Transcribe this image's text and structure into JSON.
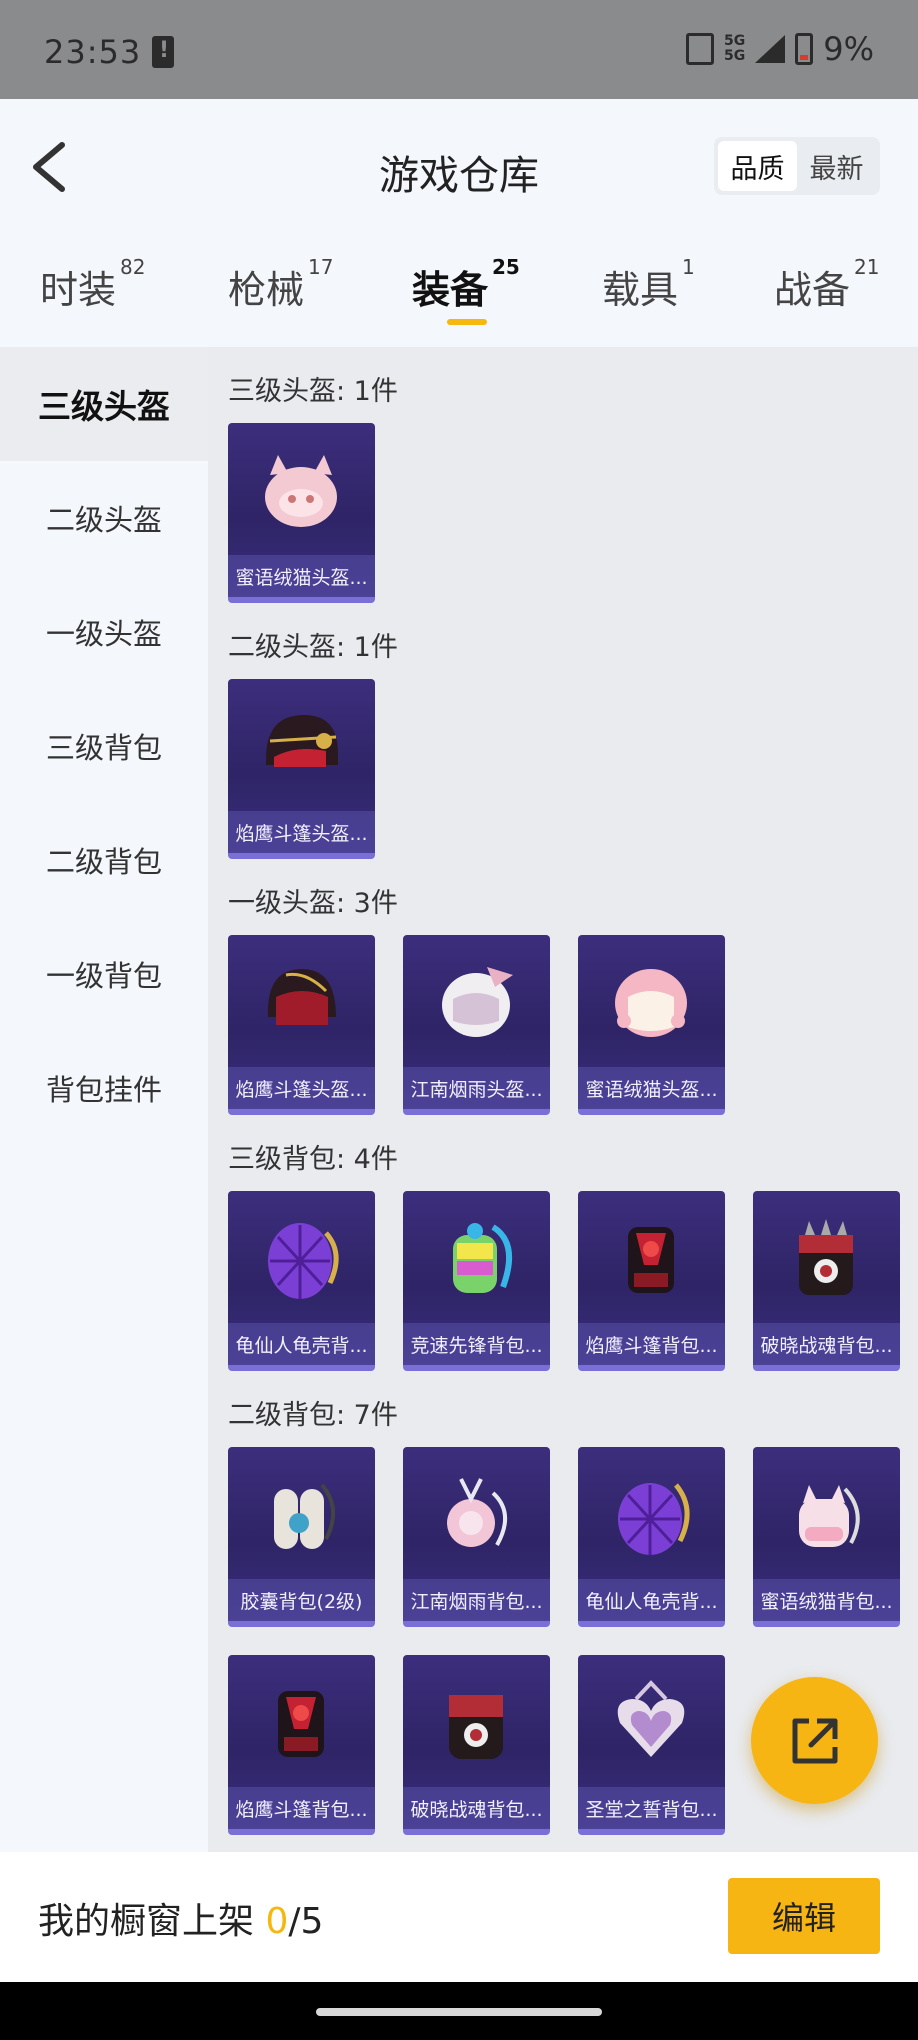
{
  "status": {
    "time": "23:53",
    "network": "5G",
    "battery": "9%"
  },
  "header": {
    "title": "游戏仓库",
    "sort_options": [
      "品质",
      "最新"
    ],
    "sort_active": "品质"
  },
  "tabs": [
    {
      "label": "时装",
      "count": "82"
    },
    {
      "label": "枪械",
      "count": "17"
    },
    {
      "label": "装备",
      "count": "25"
    },
    {
      "label": "载具",
      "count": "1"
    },
    {
      "label": "战备",
      "count": "21"
    }
  ],
  "sidebar": {
    "active": "三级头盔",
    "items": [
      "三级头盔",
      "二级头盔",
      "一级头盔",
      "三级背包",
      "二级背包",
      "一级背包",
      "背包挂件"
    ]
  },
  "sections": [
    {
      "title": "三级头盔: 1件",
      "items": [
        {
          "name": "蜜语绒猫头盔...",
          "icon": "pink-cat-helmet"
        }
      ]
    },
    {
      "title": "二级头盔: 1件",
      "items": [
        {
          "name": "焰鹰斗篷头盔...",
          "icon": "dark-red-helmet"
        }
      ]
    },
    {
      "title": "一级头盔: 3件",
      "items": [
        {
          "name": "焰鹰斗篷头盔...",
          "icon": "dark-red-helmet"
        },
        {
          "name": "江南烟雨头盔...",
          "icon": "white-winged-helmet"
        },
        {
          "name": "蜜语绒猫头盔...",
          "icon": "pink-helmet"
        }
      ]
    },
    {
      "title": "三级背包: 4件",
      "items": [
        {
          "name": "龟仙人龟壳背...",
          "icon": "turtle-shell-backpack"
        },
        {
          "name": "竞速先锋背包...",
          "icon": "rainbow-backpack"
        },
        {
          "name": "焰鹰斗篷背包...",
          "icon": "red-black-backpack"
        },
        {
          "name": "破晓战魂背包...",
          "icon": "spiked-backpack"
        }
      ]
    },
    {
      "title": "二级背包: 7件",
      "items": [
        {
          "name": "胶囊背包(2级)",
          "icon": "capsule-backpack"
        },
        {
          "name": "江南烟雨背包...",
          "icon": "flower-backpack"
        },
        {
          "name": "龟仙人龟壳背...",
          "icon": "turtle-shell-backpack"
        },
        {
          "name": "蜜语绒猫背包...",
          "icon": "cat-backpack"
        },
        {
          "name": "焰鹰斗篷背包...",
          "icon": "red-black-backpack"
        },
        {
          "name": "破晓战魂背包...",
          "icon": "spiked-backpack"
        },
        {
          "name": "圣堂之誓背包...",
          "icon": "heart-backpack"
        }
      ]
    }
  ],
  "bottom": {
    "window_label": "我的橱窗上架 ",
    "window_count": "0",
    "window_total": "/5",
    "edit_label": "编辑"
  },
  "colors": {
    "accent": "#f7b514",
    "card_bg": "#2e2466"
  }
}
